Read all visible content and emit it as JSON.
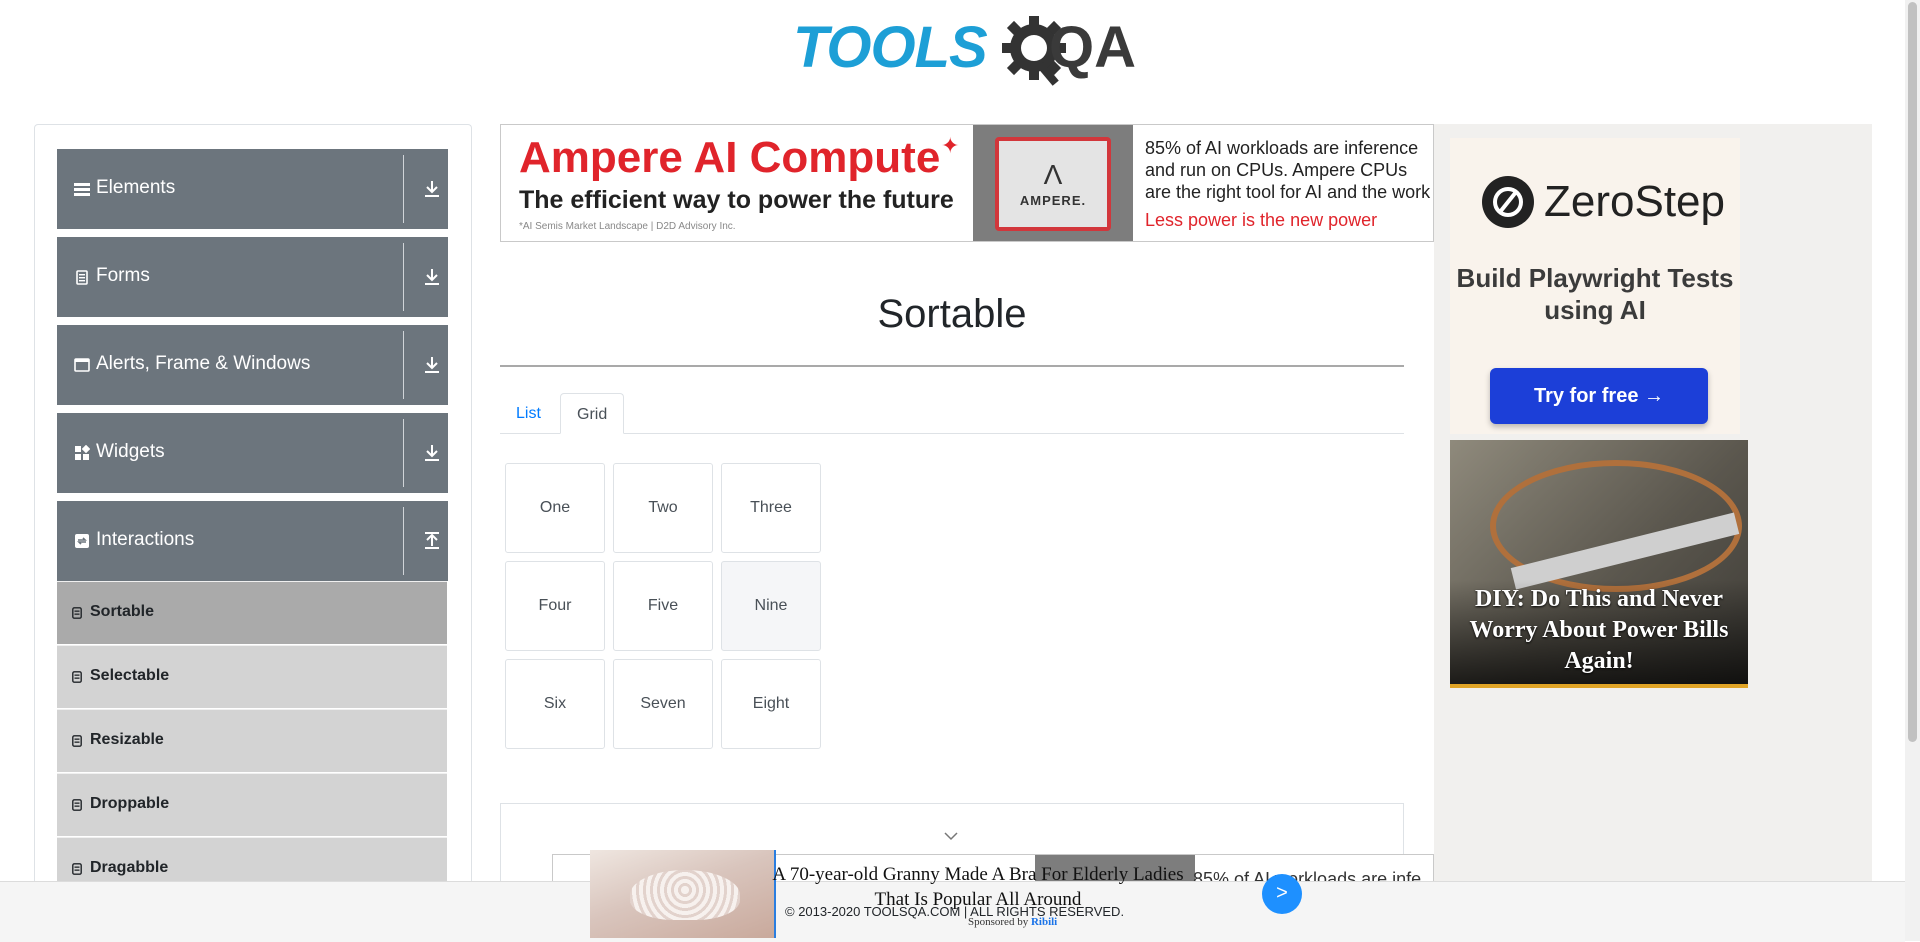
{
  "header": {
    "logo_text": "TOOLS",
    "logo_suffix": "QA"
  },
  "sidebar": {
    "groups": [
      {
        "label": "Elements",
        "icon": "bars-icon",
        "expanded": false
      },
      {
        "label": "Forms",
        "icon": "clipboard-icon",
        "expanded": false
      },
      {
        "label": "Alerts, Frame & Windows",
        "icon": "window-icon",
        "expanded": false
      },
      {
        "label": "Widgets",
        "icon": "widgets-icon",
        "expanded": false
      },
      {
        "label": "Interactions",
        "icon": "interactions-icon",
        "expanded": true
      }
    ],
    "interactions_items": [
      {
        "label": "Sortable",
        "active": true
      },
      {
        "label": "Selectable",
        "active": false
      },
      {
        "label": "Resizable",
        "active": false
      },
      {
        "label": "Droppable",
        "active": false
      },
      {
        "label": "Dragabble",
        "active": false
      }
    ]
  },
  "top_ad": {
    "headline": "Ampere AI Compute",
    "subline": "The efficient way to power the future",
    "footnote": "*AI Semis Market Landscape | D2D Advisory Inc.",
    "chip_brand": "AMPERE.",
    "body_1": "85% of AI workloads are inference",
    "body_2": "and run on CPUs. Ampere CPUs",
    "body_3": "are the right tool for AI and the work",
    "tagline": "Less power is the new power"
  },
  "main": {
    "title": "Sortable",
    "tabs": [
      {
        "label": "List",
        "active": false
      },
      {
        "label": "Grid",
        "active": true
      }
    ],
    "grid_items": [
      "One",
      "Two",
      "Three",
      "Four",
      "Five",
      "Nine",
      "Six",
      "Seven",
      "Eight"
    ]
  },
  "bottom_ad": {
    "text": "85% of AI workloads are infe"
  },
  "right_ad": {
    "brand": "ZeroStep",
    "tagline": "Build Playwright Tests using AI",
    "cta": "Try for free →",
    "story": "DIY: Do This and Never Worry About Power Bills Again!"
  },
  "sticky_ad": {
    "headline": "A 70-year-old Granny Made A Bra For Elderly Ladies That Is Popular All Around",
    "sponsor_prefix": "Sponsored by",
    "sponsor_brand": "Ribili",
    "next_label": ">"
  },
  "footer": {
    "copyright": "© 2013-2020 TOOLSQA.COM | ALL RIGHTS RESERVED."
  },
  "colors": {
    "group_bg": "#6c757d",
    "sub_bg": "#d3d3d3",
    "sub_active_bg": "#aaaaaa",
    "link_blue": "#007bff",
    "logo_blue": "#1d9fd6",
    "cta_blue": "#1c3fd8"
  }
}
